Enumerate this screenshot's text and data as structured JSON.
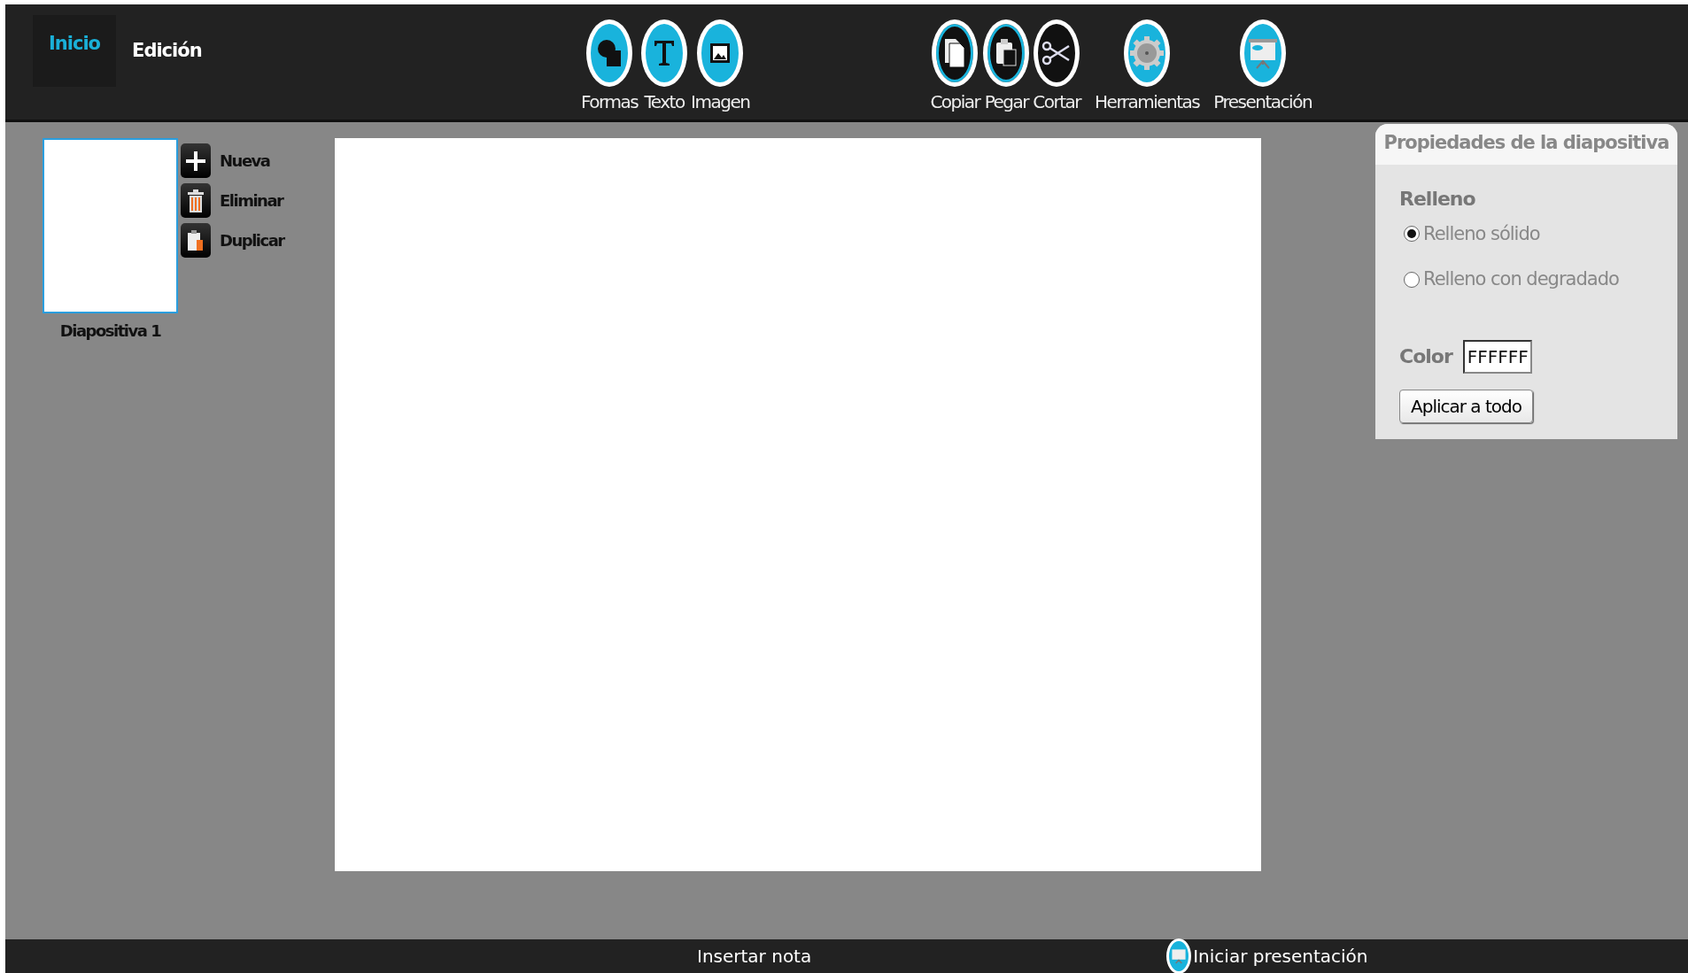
{
  "tabs": [
    {
      "label": "Inicio",
      "selected": true
    },
    {
      "label": "Edición",
      "selected": false
    }
  ],
  "tool_groups": [
    [
      {
        "kind": "shapes",
        "label": "Formas"
      },
      {
        "kind": "text",
        "label": "Texto"
      },
      {
        "kind": "image",
        "label": "Imagen"
      }
    ],
    [
      {
        "kind": "copy",
        "label": "Copiar"
      },
      {
        "kind": "paste",
        "label": "Pegar"
      },
      {
        "kind": "cut",
        "label": "Cortar"
      },
      {
        "kind": "tools",
        "label": "Herramientas"
      },
      {
        "kind": "present",
        "label": "Presentación"
      }
    ]
  ],
  "slides": [
    {
      "label": "Diapositiva 1",
      "selected": true
    }
  ],
  "slide_actions": [
    {
      "kind": "new",
      "label": "Nueva"
    },
    {
      "kind": "delete",
      "label": "Eliminar"
    },
    {
      "kind": "duplicate",
      "label": "Duplicar"
    }
  ],
  "properties_panel": {
    "title": "Propiedades de la diapositiva",
    "section": "Relleno",
    "fill_options": [
      {
        "label": "Relleno sólido",
        "selected": true
      },
      {
        "label": "Relleno con degradado",
        "selected": false
      }
    ],
    "color_label": "Color",
    "color_value": "FFFFFF",
    "apply_button": "Aplicar a todo"
  },
  "status_bar": {
    "note": "Insertar nota",
    "start": "Iniciar presentación"
  }
}
